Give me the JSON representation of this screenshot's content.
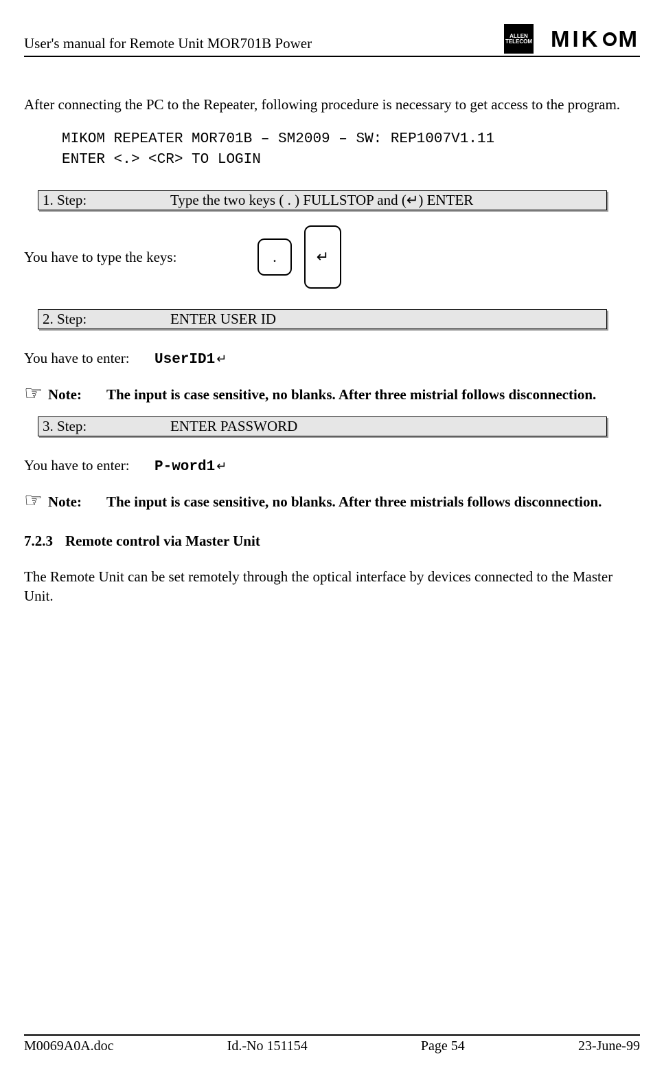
{
  "header": {
    "title": "User's manual for Remote Unit MOR701B Power",
    "logo_allen_l1": "ALLEN",
    "logo_allen_l2": "TELECOM",
    "logo_mikom_pre": "MIK",
    "logo_mikom_post": "M"
  },
  "intro": "After connecting the PC to the Repeater, following procedure is necessary to get access to the program.",
  "terminal": "MIKOM REPEATER MOR701B – SM2009 – SW: REP1007V1.11\nENTER <.> <CR> TO LOGIN",
  "steps": [
    {
      "label": "1. Step:",
      "text": "Type the two keys ( . ) FULLSTOP and (↵) ENTER"
    },
    {
      "label": "2. Step:",
      "text": "ENTER USER ID"
    },
    {
      "label": "3. Step:",
      "text": "ENTER PASSWORD"
    }
  ],
  "keys_label": "You have to type the keys:",
  "key1_glyph": ".",
  "key2_glyph": "↵",
  "enter1": {
    "label": "You have to enter:",
    "value": "UserID1",
    "ret": "↵"
  },
  "enter2": {
    "label": "You have to enter:",
    "value": "P-word1",
    "ret": "↵"
  },
  "notes": [
    {
      "icon": "☞",
      "label": "Note:",
      "text": "The input is case sensitive, no blanks. After three mistrial follows disconnection."
    },
    {
      "icon": "☞",
      "label": "Note:",
      "text": "The input is case sensitive, no blanks. After three mistrials follows disconnection."
    }
  ],
  "section": {
    "num": "7.2.3",
    "title": "Remote control via Master Unit"
  },
  "section_body": "The Remote Unit can be set remotely through the optical interface by devices connected to the Master Unit.",
  "footer": {
    "doc": "M0069A0A.doc",
    "id": "Id.-No 151154",
    "page": "Page 54",
    "date": "23-June-99"
  }
}
